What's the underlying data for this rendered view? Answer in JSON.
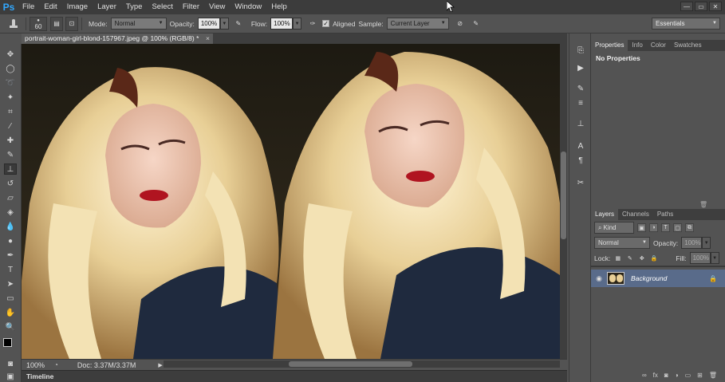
{
  "app": {
    "logo": "Ps"
  },
  "menu": [
    "File",
    "Edit",
    "Image",
    "Layer",
    "Type",
    "Select",
    "Filter",
    "View",
    "Window",
    "Help"
  ],
  "window_controls": [
    "—",
    "▭",
    "✕"
  ],
  "options_bar": {
    "brush_size": "60",
    "mode_label": "Mode:",
    "mode_value": "Normal",
    "opacity_label": "Opacity:",
    "opacity_value": "100%",
    "flow_label": "Flow:",
    "flow_value": "100%",
    "aligned_label": "Aligned",
    "sample_label": "Sample:",
    "sample_value": "Current Layer",
    "workspace": "Essentials"
  },
  "document": {
    "tab_title": "portrait-woman-girl-blond-157967.jpeg @ 100% (RGB/8) *",
    "close": "×"
  },
  "status": {
    "zoom": "100%",
    "doc_info": "Doc: 3.37M/3.37M"
  },
  "timeline": {
    "label": "Timeline"
  },
  "properties_panel": {
    "tabs": [
      "Properties",
      "Info",
      "Color",
      "Swatches"
    ],
    "content": "No Properties"
  },
  "layers_panel": {
    "tabs": [
      "Layers",
      "Channels",
      "Paths"
    ],
    "filter_kind": "Kind",
    "blend_mode": "Normal",
    "opacity_label": "Opacity:",
    "opacity_value": "100%",
    "lock_label": "Lock:",
    "fill_label": "Fill:",
    "fill_value": "100%",
    "layers": [
      {
        "name": "Background"
      }
    ]
  },
  "colors": {
    "accent": "#31a8ff",
    "selected_layer": "#596b8a"
  }
}
